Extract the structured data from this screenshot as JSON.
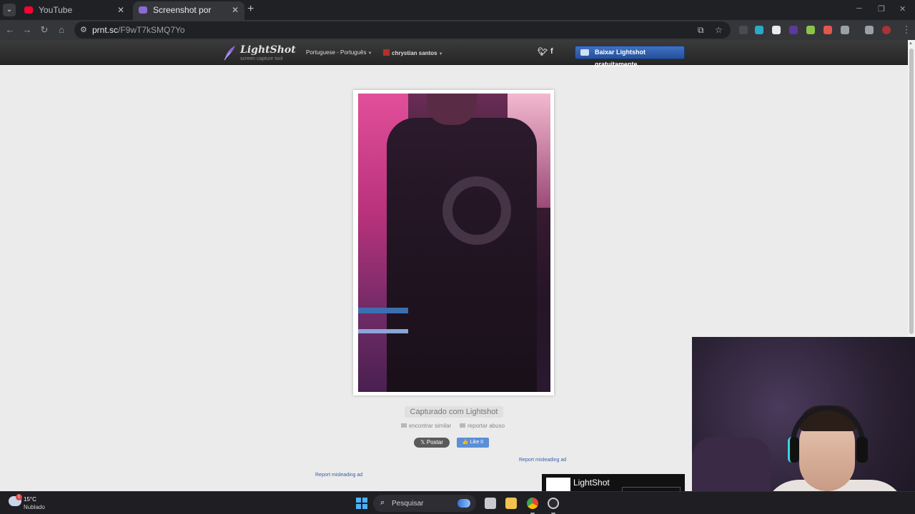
{
  "browser": {
    "tabs": [
      {
        "title": "YouTube",
        "active": false,
        "favicon_color": "#ff0033"
      },
      {
        "title": "Screenshot por Lightshot",
        "active": true,
        "favicon_color": "#8a6bd6"
      }
    ],
    "url_host": "prnt.sc",
    "url_path": "/F9wT7kSMQ7Yo"
  },
  "lightshot": {
    "logo_name": "LightShot",
    "logo_tagline": "screen capture tool",
    "language": "Portuguese - Português",
    "username": "chrystian santos",
    "download_button": "Baixar Lightshot gratuitamente",
    "captured_label": "Capturado com Lightshot",
    "find_similar": "encontrar similar",
    "report_abuse": "reportar abuso",
    "post_button": "𝕏 Postar",
    "like_button": "👍 Like 0",
    "report_ad_1": "Report misleading ad",
    "report_ad_2": "Report misleading ad",
    "ad_title": "LightShot"
  },
  "taskbar": {
    "temperature": "15°C",
    "condition": "Nublado",
    "weather_badge": "1",
    "search_placeholder": "Pesquisar"
  },
  "colors": {
    "accent_blue": "#3b6fc2",
    "header_dark": "#2b2b2b",
    "page_bg": "#ebebeb"
  }
}
